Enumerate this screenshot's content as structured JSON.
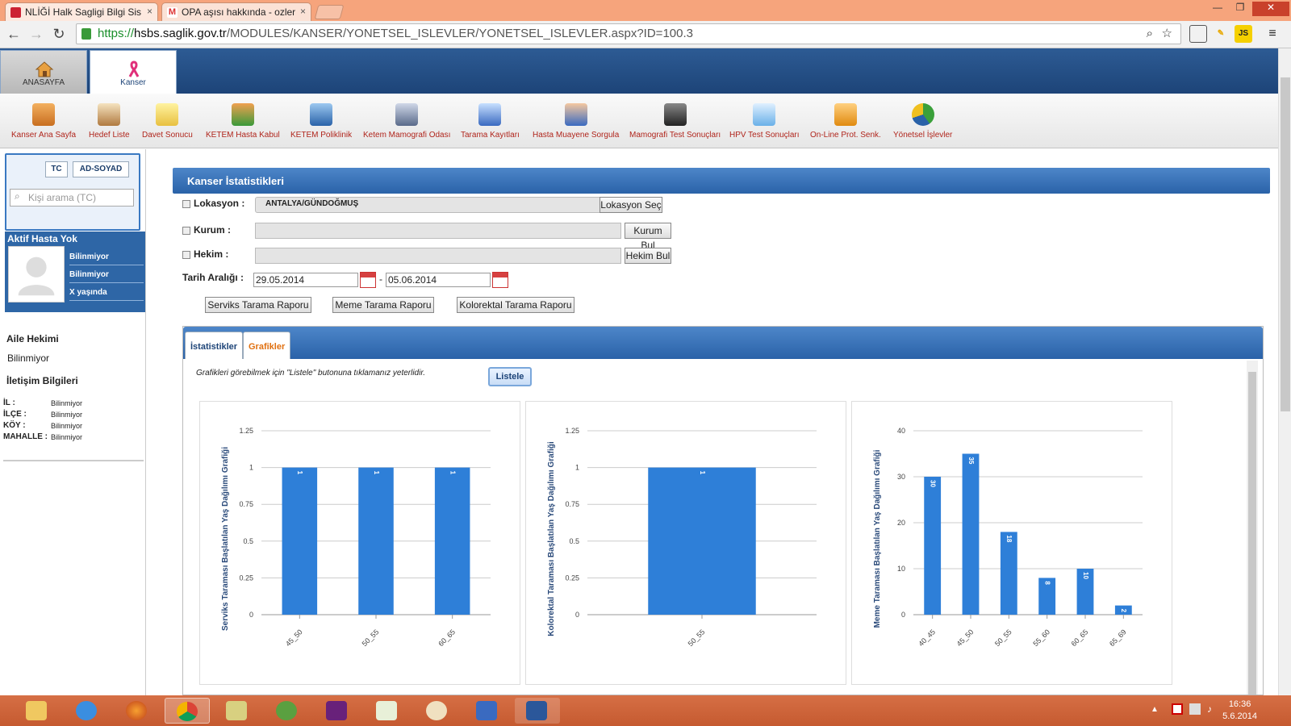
{
  "browser": {
    "tabs": [
      {
        "title": "NLİĞİ Halk Sagligi Bilgi Sis",
        "close": "×"
      },
      {
        "title": "OPA aşısı hakkında - ozler",
        "close": "×"
      }
    ],
    "url_scheme": "https://",
    "url_host": "hsbs.saglik.gov.tr",
    "url_path": "/MODULES/KANSER/YONETSEL_ISLEVLER/YONETSEL_ISLEVLER.aspx?ID=100.3",
    "ext_js": "JS"
  },
  "app": {
    "tabs": [
      {
        "label": "ANASAYFA"
      },
      {
        "label": "Kanser"
      }
    ],
    "toolbar": [
      "Kanser Ana Sayfa",
      "Hedef Liste",
      "Davet Sonucu",
      "KETEM Hasta Kabul",
      "KETEM Poliklinik",
      "Ketem Mamografi Odası",
      "Tarama Kayıtları",
      "Hasta Muayene Sorgula",
      "Mamografi Test Sonuçları",
      "HPV Test Sonuçları",
      "On-Line Prot. Senk.",
      "Yönetsel İşlevler"
    ]
  },
  "sidebar": {
    "tc_label": "TC",
    "adsoyad_label": "AD-SOYAD",
    "search_placeholder": "Kişi arama (TC)",
    "active_patient": "Aktif Hasta Yok",
    "patient_info": [
      "Bilinmiyor",
      "Bilinmiyor",
      "X yaşında"
    ],
    "family_doctor_title": "Aile Hekimi",
    "family_doctor": "Bilinmiyor",
    "contact_title": "İletişim Bilgileri",
    "contact": [
      {
        "key": "İL :",
        "value": "Bilinmiyor"
      },
      {
        "key": "İLÇE :",
        "value": "Bilinmiyor"
      },
      {
        "key": "KÖY :",
        "value": "Bilinmiyor"
      },
      {
        "key": "MAHALLE :",
        "value": "Bilinmiyor"
      }
    ]
  },
  "main": {
    "title": "Kanser İstatistikleri",
    "lokasyon_label": "Lokasyon :",
    "lokasyon_value": "ANTALYA/GÜNDOĞMUŞ",
    "lokasyon_btn": "Lokasyon Seç",
    "kurum_label": "Kurum :",
    "kurum_btn": "Kurum Bul",
    "hekim_label": "Hekim :",
    "hekim_btn": "Hekim Bul",
    "tarih_label": "Tarih Aralığı :",
    "date_from": "29.05.2014",
    "date_sep": "-",
    "date_to": "05.06.2014",
    "report_btns": [
      "Serviks Tarama Raporu",
      "Meme Tarama Raporu",
      "Kolorektal Tarama Raporu"
    ],
    "tabs": [
      "İstatistikler",
      "Grafikler"
    ],
    "hint": "Grafikleri görebilmek için \"Listele\" butonuna tıklamanız yeterlidir.",
    "listele": "Listele"
  },
  "taskbar": {
    "time": "16:36",
    "date": "5.6.2014"
  },
  "colors": {
    "bar": "#2e7fd8",
    "header": "#1d4478",
    "accent": "#b0251c"
  },
  "chart_data": [
    {
      "type": "bar",
      "ylabel": "Serviks Taraması Başlatılan Yaş Dağılımı Grafiği",
      "categories": [
        "45_50",
        "50_55",
        "60_65"
      ],
      "values": [
        1,
        1,
        1
      ],
      "ylim": [
        0,
        1.25
      ],
      "yticks": [
        0,
        0.25,
        0.5,
        0.75,
        1,
        1.25
      ],
      "grid": true
    },
    {
      "type": "bar",
      "ylabel": "Kolorektal Taraması Başlatılan Yaş Dağılımı Grafiği",
      "categories": [
        "50_55"
      ],
      "values": [
        1
      ],
      "ylim": [
        0,
        1.25
      ],
      "yticks": [
        0,
        0.25,
        0.5,
        0.75,
        1,
        1.25
      ],
      "grid": true
    },
    {
      "type": "bar",
      "ylabel": "Meme Taraması Başlatılan Yaş Dağılımı Grafiği",
      "categories": [
        "40_45",
        "45_50",
        "50_55",
        "55_60",
        "60_65",
        "65_69"
      ],
      "values": [
        30,
        35,
        18,
        8,
        10,
        2
      ],
      "ylim": [
        0,
        40
      ],
      "yticks": [
        0,
        10,
        20,
        30,
        40
      ],
      "grid": true
    }
  ]
}
